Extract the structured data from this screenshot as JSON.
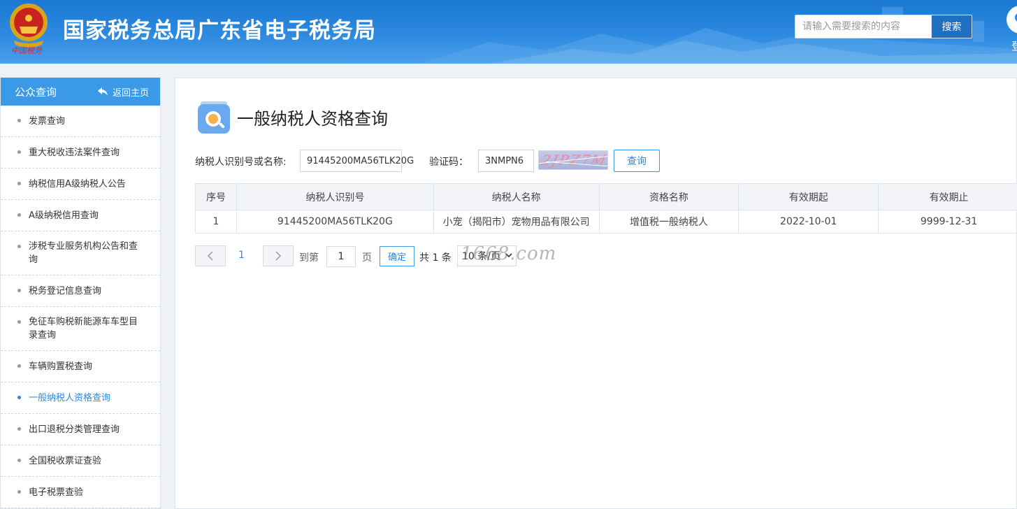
{
  "header": {
    "site_title": "国家税务总局广东省电子税务局",
    "emblem_caption": "中国税务",
    "search_placeholder": "请输入需要搜索的内容",
    "search_button": "搜索",
    "login_char": "登"
  },
  "sidebar": {
    "title": "公众查询",
    "back_label": "返回主页",
    "items": [
      {
        "label": "发票查询"
      },
      {
        "label": "重大税收违法案件查询"
      },
      {
        "label": "纳税信用A级纳税人公告"
      },
      {
        "label": "A级纳税信用查询"
      },
      {
        "label": "涉税专业服务机构公告和查询"
      },
      {
        "label": "税务登记信息查询"
      },
      {
        "label": "免征车购税新能源车车型目录查询"
      },
      {
        "label": "车辆购置税查询"
      },
      {
        "label": "一般纳税人资格查询",
        "active": true
      },
      {
        "label": "出口退税分类管理查询"
      },
      {
        "label": "全国税收票证查验"
      },
      {
        "label": "电子税票查验"
      }
    ]
  },
  "main": {
    "page_title": "一般纳税人资格查询",
    "form": {
      "taxpayer_label": "纳税人识别号或名称:",
      "taxpayer_value": "91445200MA56TLK20G",
      "captcha_label": "验证码：",
      "captcha_value": "3NMPN6",
      "captcha_image_text": "2JPZ7M",
      "query_button": "查询"
    },
    "table": {
      "headers": [
        "序号",
        "纳税人识别号",
        "纳税人名称",
        "资格名称",
        "有效期起",
        "有效期止"
      ],
      "rows": [
        [
          "1",
          "91445200MA56TLK20G",
          "小宠（揭阳市）宠物用品有限公司",
          "增值税一般纳税人",
          "2022-10-01",
          "9999-12-31"
        ]
      ]
    },
    "pagination": {
      "current_page": "1",
      "goto_prefix": "到第",
      "goto_value": "1",
      "goto_suffix": "页",
      "confirm": "确定",
      "total": "共 1 条",
      "page_size": "10 条/页",
      "watermark": "1668.com"
    }
  },
  "colors": {
    "header_blue": "#2d8ae0",
    "sidebar_head": "#3b9ae8",
    "active_link": "#2d88e0"
  }
}
